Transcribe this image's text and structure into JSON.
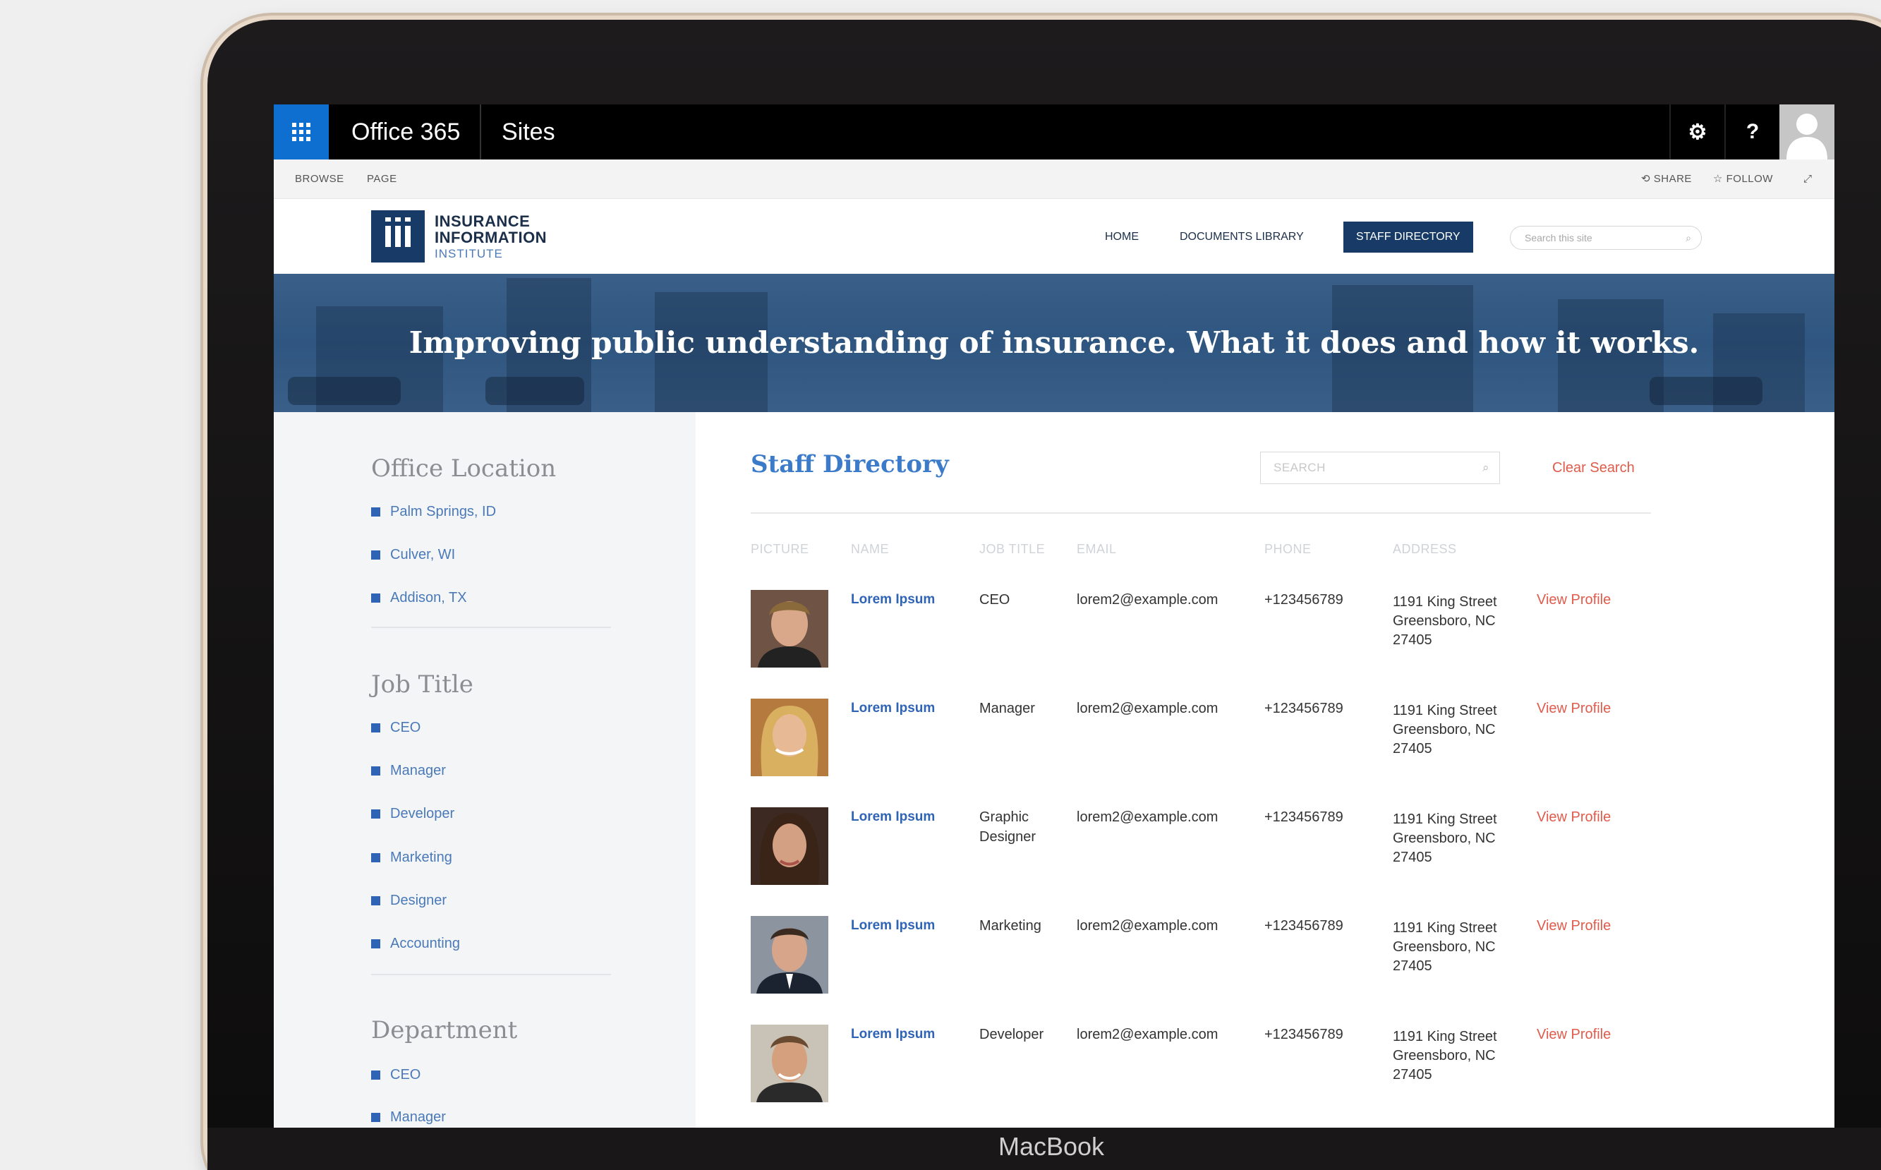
{
  "suite": {
    "app_title": "Office 365",
    "sites_label": "Sites",
    "settings_glyph": "⚙",
    "help_glyph": "?"
  },
  "ribbon": {
    "browse": "BROWSE",
    "page": "PAGE",
    "share": "SHARE",
    "follow": "FOLLOW"
  },
  "logo": {
    "line1": "INSURANCE",
    "line2": "INFORMATION",
    "line3": "INSTITUTE"
  },
  "nav": {
    "home": "HOME",
    "documents": "DOCUMENTS LIBRARY",
    "staff": "STAFF DIRECTORY",
    "search_placeholder": "Search this site"
  },
  "banner": {
    "headline": "Improving public understanding of insurance. What it does and how it works."
  },
  "sidebar": {
    "office_location": {
      "title": "Office Location",
      "items": [
        "Palm Springs, ID",
        "Culver, WI",
        "Addison, TX"
      ]
    },
    "job_title": {
      "title": "Job Title",
      "items": [
        "CEO",
        "Manager",
        "Developer",
        "Marketing",
        "Designer",
        "Accounting"
      ]
    },
    "department": {
      "title": "Department",
      "items": [
        "CEO",
        "Manager"
      ]
    }
  },
  "directory": {
    "title": "Staff Directory",
    "search_placeholder": "SEARCH",
    "clear_search": "Clear Search",
    "columns": [
      "PICTURE",
      "NAME",
      "JOB TITLE",
      "EMAIL",
      "PHONE",
      "ADDRESS"
    ],
    "rows": [
      {
        "name": "Lorem Ipsum",
        "job": "CEO",
        "email": "lorem2@example.com",
        "phone": "+123456789",
        "addr1": "1191 King Street",
        "addr2": "Greensboro, NC",
        "addr3": "27405",
        "action": "View Profile"
      },
      {
        "name": "Lorem Ipsum",
        "job": "Manager",
        "email": "lorem2@example.com",
        "phone": "+123456789",
        "addr1": "1191 King Street",
        "addr2": "Greensboro, NC",
        "addr3": "27405",
        "action": "View Profile"
      },
      {
        "name": "Lorem Ipsum",
        "job": "Graphic Designer",
        "email": "lorem2@example.com",
        "phone": "+123456789",
        "addr1": "1191 King Street",
        "addr2": "Greensboro, NC",
        "addr3": "27405",
        "action": "View Profile"
      },
      {
        "name": "Lorem Ipsum",
        "job": "Marketing",
        "email": "lorem2@example.com",
        "phone": "+123456789",
        "addr1": "1191 King Street",
        "addr2": "Greensboro, NC",
        "addr3": "27405",
        "action": "View Profile"
      },
      {
        "name": "Lorem Ipsum",
        "job": "Developer",
        "email": "lorem2@example.com",
        "phone": "+123456789",
        "addr1": "1191 King Street",
        "addr2": "Greensboro, NC",
        "addr3": "27405",
        "action": "View Profile"
      }
    ]
  },
  "device": {
    "brand": "MacBook"
  },
  "colors": {
    "accent_blue": "#0e6fd1",
    "navy": "#173b66",
    "link_blue": "#2f63b5",
    "action_red": "#e05b4b"
  }
}
